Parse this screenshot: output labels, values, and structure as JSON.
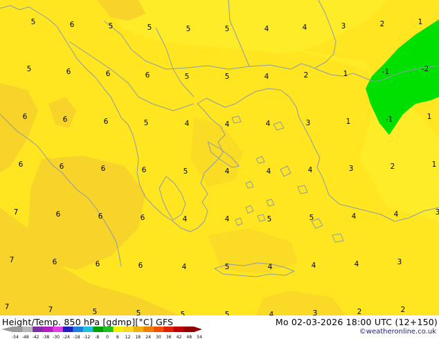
{
  "footer": {
    "title": "Height/Temp. 850 hPa [gdmp][°C] GFS",
    "datetime": "Mo 02-03-2026 18:00 UTC (12+150)",
    "credit": "©weatheronline.co.uk"
  },
  "colorbar": {
    "ticks": [
      "-54",
      "-48",
      "-42",
      "-38",
      "-30",
      "-24",
      "-18",
      "-12",
      "-8",
      "0",
      "8",
      "12",
      "18",
      "24",
      "30",
      "36",
      "42",
      "48",
      "54"
    ],
    "colors": [
      "#9a9a9a",
      "#b8b8b8",
      "#7d30a0",
      "#b020c0",
      "#e040e0",
      "#2020c0",
      "#2080e0",
      "#20c0e0",
      "#00a000",
      "#20c020",
      "#f0f000",
      "#f8d820",
      "#f0b010",
      "#f08000",
      "#f05000",
      "#e02000",
      "#c00000",
      "#900000"
    ]
  },
  "map": {
    "region": "Balkans / Aegean",
    "colors": {
      "main": "#ffe620",
      "light": "#fff030",
      "dark": "#f8d42a",
      "cold": "#00e000",
      "coast": "#8d9aa8"
    },
    "labels": [
      {
        "t": "5",
        "c": [
          48,
          35
        ]
      },
      {
        "t": "6",
        "c": [
          104,
          39
        ]
      },
      {
        "t": "5",
        "c": [
          160,
          41
        ]
      },
      {
        "t": "5",
        "c": [
          216,
          43
        ]
      },
      {
        "t": "5",
        "c": [
          272,
          45
        ]
      },
      {
        "t": "5",
        "c": [
          328,
          45
        ]
      },
      {
        "t": "4",
        "c": [
          385,
          45
        ]
      },
      {
        "t": "4",
        "c": [
          440,
          43
        ]
      },
      {
        "t": "3",
        "c": [
          496,
          41
        ]
      },
      {
        "t": "2",
        "c": [
          552,
          38
        ]
      },
      {
        "t": "1",
        "c": [
          607,
          35
        ]
      },
      {
        "t": "5",
        "c": [
          42,
          103
        ]
      },
      {
        "t": "6",
        "c": [
          99,
          107
        ]
      },
      {
        "t": "6",
        "c": [
          156,
          110
        ]
      },
      {
        "t": "6",
        "c": [
          213,
          112
        ]
      },
      {
        "t": "5",
        "c": [
          270,
          114
        ]
      },
      {
        "t": "5",
        "c": [
          328,
          114
        ]
      },
      {
        "t": "4",
        "c": [
          385,
          114
        ]
      },
      {
        "t": "2",
        "c": [
          442,
          112
        ]
      },
      {
        "t": "1",
        "c": [
          499,
          110
        ]
      },
      {
        "t": "-1",
        "c": [
          557,
          107
        ]
      },
      {
        "t": "-2",
        "c": [
          614,
          103
        ]
      },
      {
        "t": "6",
        "c": [
          36,
          172
        ]
      },
      {
        "t": "6",
        "c": [
          94,
          176
        ]
      },
      {
        "t": "6",
        "c": [
          153,
          179
        ]
      },
      {
        "t": "5",
        "c": [
          211,
          181
        ]
      },
      {
        "t": "4",
        "c": [
          270,
          182
        ]
      },
      {
        "t": "4",
        "c": [
          328,
          183
        ]
      },
      {
        "t": "4",
        "c": [
          387,
          182
        ]
      },
      {
        "t": "3",
        "c": [
          445,
          181
        ]
      },
      {
        "t": "1",
        "c": [
          503,
          179
        ]
      },
      {
        "t": "-1",
        "c": [
          562,
          176
        ]
      },
      {
        "t": "1",
        "c": [
          620,
          172
        ]
      },
      {
        "t": "6",
        "c": [
          30,
          241
        ]
      },
      {
        "t": "6",
        "c": [
          89,
          244
        ]
      },
      {
        "t": "6",
        "c": [
          149,
          247
        ]
      },
      {
        "t": "6",
        "c": [
          208,
          249
        ]
      },
      {
        "t": "5",
        "c": [
          268,
          251
        ]
      },
      {
        "t": "4",
        "c": [
          328,
          251
        ]
      },
      {
        "t": "4",
        "c": [
          388,
          251
        ]
      },
      {
        "t": "4",
        "c": [
          448,
          249
        ]
      },
      {
        "t": "3",
        "c": [
          507,
          247
        ]
      },
      {
        "t": "2",
        "c": [
          567,
          244
        ]
      },
      {
        "t": "1",
        "c": [
          627,
          241
        ]
      },
      {
        "t": "7",
        "c": [
          23,
          310
        ]
      },
      {
        "t": "6",
        "c": [
          84,
          313
        ]
      },
      {
        "t": "6",
        "c": [
          145,
          316
        ]
      },
      {
        "t": "6",
        "c": [
          206,
          318
        ]
      },
      {
        "t": "4",
        "c": [
          267,
          320
        ]
      },
      {
        "t": "4",
        "c": [
          328,
          320
        ]
      },
      {
        "t": "5",
        "c": [
          389,
          320
        ]
      },
      {
        "t": "5",
        "c": [
          450,
          318
        ]
      },
      {
        "t": "4",
        "c": [
          511,
          316
        ]
      },
      {
        "t": "4",
        "c": [
          572,
          313
        ]
      },
      {
        "t": "3",
        "c": [
          632,
          310
        ]
      },
      {
        "t": "7",
        "c": [
          17,
          379
        ]
      },
      {
        "t": "6",
        "c": [
          79,
          382
        ]
      },
      {
        "t": "6",
        "c": [
          141,
          385
        ]
      },
      {
        "t": "6",
        "c": [
          203,
          387
        ]
      },
      {
        "t": "4",
        "c": [
          266,
          389
        ]
      },
      {
        "t": "5",
        "c": [
          328,
          389
        ]
      },
      {
        "t": "4",
        "c": [
          390,
          389
        ]
      },
      {
        "t": "4",
        "c": [
          453,
          387
        ]
      },
      {
        "t": "4",
        "c": [
          515,
          385
        ]
      },
      {
        "t": "3",
        "c": [
          577,
          382
        ]
      },
      {
        "t": "7",
        "c": [
          10,
          447
        ]
      },
      {
        "t": "7",
        "c": [
          73,
          451
        ]
      },
      {
        "t": "5",
        "c": [
          137,
          454
        ]
      },
      {
        "t": "5",
        "c": [
          200,
          456
        ]
      },
      {
        "t": "5",
        "c": [
          264,
          458
        ]
      },
      {
        "t": "5",
        "c": [
          328,
          458
        ]
      },
      {
        "t": "4",
        "c": [
          392,
          458
        ]
      },
      {
        "t": "3",
        "c": [
          455,
          456
        ]
      },
      {
        "t": "2",
        "c": [
          519,
          454
        ]
      },
      {
        "t": "2",
        "c": [
          582,
          451
        ]
      }
    ]
  }
}
